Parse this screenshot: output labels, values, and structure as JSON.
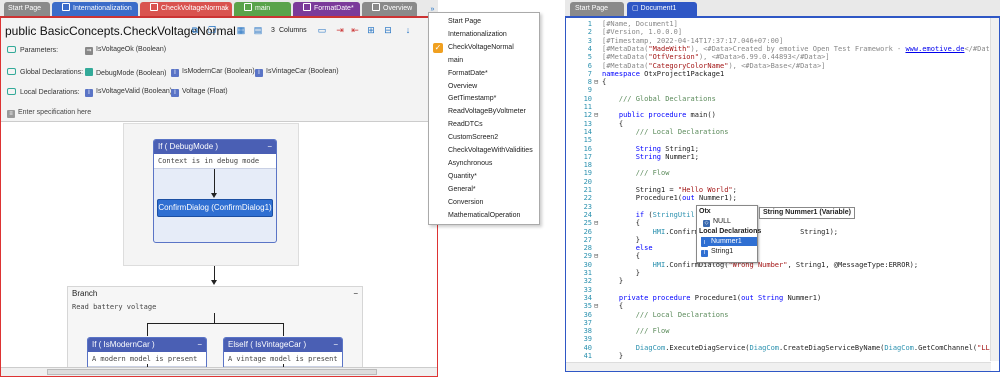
{
  "left": {
    "tabs": [
      {
        "label": "Start Page",
        "color": "#8a8a8a"
      },
      {
        "label": "Internationalization",
        "color": "#3b6cc9"
      },
      {
        "label": "CheckVoltageNormal",
        "color": "#d9534f"
      },
      {
        "label": "main",
        "color": "#5aa34a"
      },
      {
        "label": "FormatDate*",
        "color": "#7b3a9a"
      },
      {
        "label": "Overview",
        "color": "#8a8a8a"
      }
    ],
    "title": "public BasicConcepts.CheckVoltageNormal",
    "columns_label": "3",
    "columns_text": "Columns",
    "parameters_label": "Parameters:",
    "global_label": "Global Declarations:",
    "local_label": "Local Declarations:",
    "params": [
      "IsVoltageOk (Boolean)"
    ],
    "globals": [
      "DebugMode (Boolean)",
      "IsModernCar (Boolean)",
      "IsVintageCar (Boolean)"
    ],
    "locals": [
      "IsVoltageValid (Boolean)",
      "Voltage (Float)"
    ],
    "spec_placeholder": "Enter specification here",
    "if_debug": {
      "title": "If ( DebugMode )",
      "desc": "Context is in debug mode",
      "action": "ConfirmDialog (ConfirmDialog1)"
    },
    "branch": {
      "title": "Branch",
      "desc": "Read battery voltage"
    },
    "if_modern": {
      "title": "If ( IsModernCar )",
      "desc": "A modern model is present"
    },
    "elseif_vintage": {
      "title": "ElseIf ( IsVintageCar )",
      "desc": "A vintage model is present"
    }
  },
  "dropdown": {
    "items": [
      "Start Page",
      "Internationalization",
      "CheckVoltageNormal",
      "main",
      "FormatDate*",
      "Overview",
      "GetTimestamp*",
      "ReadVoltageByVoltmeter",
      "ReadDTCs",
      "CustomScreen2",
      "CheckVoltageWithValidities",
      "Asynchronous",
      "Quantity*",
      "General*",
      "Conversion",
      "MathematicalOperation"
    ],
    "checked_index": 2
  },
  "right": {
    "tabs": [
      {
        "label": "Start Page",
        "color": "#8a8a8a"
      },
      {
        "label": "Document1",
        "color": "#2f57c5"
      }
    ],
    "code_lines": [
      {
        "n": "1",
        "parts": [
          [
            "cm",
            "[#Name, Document1]"
          ]
        ]
      },
      {
        "n": "2",
        "parts": [
          [
            "cm",
            "[#Version, 1.0.0.0]"
          ]
        ]
      },
      {
        "n": "3",
        "parts": [
          [
            "cm",
            "[#Timestamp, 2022-04-14T17:37:17.046+07:00]"
          ]
        ]
      },
      {
        "n": "4",
        "parts": [
          [
            "cm",
            "[#MetaData("
          ],
          [
            "str",
            "\"MadeWith\""
          ],
          [
            "cm",
            "), <#Data>Created by emotive Open Test Framework - "
          ],
          [
            "url",
            "www.emotive.de"
          ],
          [
            "cm",
            "</#Data>]"
          ]
        ]
      },
      {
        "n": "5",
        "parts": [
          [
            "cm",
            "[#MetaData("
          ],
          [
            "str",
            "\"OtfVersion\""
          ],
          [
            "cm",
            "), <#Data>6.99.0.44893</#Data>]"
          ]
        ]
      },
      {
        "n": "6",
        "parts": [
          [
            "cm",
            "[#MetaData("
          ],
          [
            "str",
            "\"CategoryColorName\""
          ],
          [
            "cm",
            "), <#Data>Base</#Data>]"
          ]
        ]
      },
      {
        "n": "7",
        "parts": [
          [
            "kw",
            "namespace"
          ],
          [
            "fn",
            " OtxProject1Package1"
          ]
        ]
      },
      {
        "n": "8",
        "parts": [
          [
            "fn",
            "{"
          ]
        ]
      },
      {
        "n": "9",
        "parts": [
          [
            "fn",
            ""
          ]
        ]
      },
      {
        "n": "10",
        "parts": [
          [
            "grn",
            "    /// Global Declarations"
          ]
        ]
      },
      {
        "n": "11",
        "parts": [
          [
            "fn",
            ""
          ]
        ]
      },
      {
        "n": "12",
        "parts": [
          [
            "kw",
            "    public procedure"
          ],
          [
            "fn",
            " main()"
          ]
        ]
      },
      {
        "n": "13",
        "parts": [
          [
            "fn",
            "    {"
          ]
        ]
      },
      {
        "n": "14",
        "parts": [
          [
            "grn",
            "        /// Local Declarations"
          ]
        ]
      },
      {
        "n": "15",
        "parts": [
          [
            "fn",
            ""
          ]
        ]
      },
      {
        "n": "16",
        "parts": [
          [
            "kw",
            "        String"
          ],
          [
            "fn",
            " String1;"
          ]
        ]
      },
      {
        "n": "17",
        "parts": [
          [
            "kw",
            "        String"
          ],
          [
            "fn",
            " Nummer1;"
          ]
        ]
      },
      {
        "n": "18",
        "parts": [
          [
            "fn",
            ""
          ]
        ]
      },
      {
        "n": "19",
        "parts": [
          [
            "grn",
            "        /// Flow"
          ]
        ]
      },
      {
        "n": "20",
        "parts": [
          [
            "fn",
            ""
          ]
        ]
      },
      {
        "n": "21",
        "parts": [
          [
            "fn",
            "        String1 = "
          ],
          [
            "str",
            "\"Hello World\""
          ],
          [
            "fn",
            ";"
          ]
        ]
      },
      {
        "n": "22",
        "parts": [
          [
            "fn",
            "        Procedure1("
          ],
          [
            "kw",
            "out"
          ],
          [
            "fn",
            " Nummer1);"
          ]
        ]
      },
      {
        "n": "23",
        "parts": [
          [
            "fn",
            ""
          ]
        ]
      },
      {
        "n": "24",
        "parts": [
          [
            "kw",
            "        if"
          ],
          [
            "fn",
            " ("
          ],
          [
            "cls",
            "StringUtil"
          ],
          [
            "fn",
            "..."
          ]
        ]
      },
      {
        "n": "25",
        "parts": [
          [
            "fn",
            "        {"
          ]
        ]
      },
      {
        "n": "26",
        "parts": [
          [
            "cls",
            "            HMI"
          ],
          [
            "fn",
            ".ConfirmD"
          ],
          [
            "fn",
            "                       String1);"
          ]
        ]
      },
      {
        "n": "27",
        "parts": [
          [
            "fn",
            "        }"
          ]
        ]
      },
      {
        "n": "28",
        "parts": [
          [
            "kw",
            "        else"
          ]
        ]
      },
      {
        "n": "29",
        "parts": [
          [
            "fn",
            "        {"
          ]
        ]
      },
      {
        "n": "30",
        "parts": [
          [
            "cls",
            "            HMI"
          ],
          [
            "fn",
            ".ConfirmDialog("
          ],
          [
            "str",
            "\"Wrong Number\""
          ],
          [
            "fn",
            ", String1, @MessageType:ERROR);"
          ]
        ]
      },
      {
        "n": "31",
        "parts": [
          [
            "fn",
            "        }"
          ]
        ]
      },
      {
        "n": "32",
        "parts": [
          [
            "fn",
            "    }"
          ]
        ]
      },
      {
        "n": "33",
        "parts": [
          [
            "fn",
            ""
          ]
        ]
      },
      {
        "n": "34",
        "parts": [
          [
            "kw",
            "    private procedure"
          ],
          [
            "fn",
            " Procedure1("
          ],
          [
            "kw",
            "out String"
          ],
          [
            "fn",
            " Nummer1)"
          ]
        ]
      },
      {
        "n": "35",
        "parts": [
          [
            "fn",
            "    {"
          ]
        ]
      },
      {
        "n": "36",
        "parts": [
          [
            "grn",
            "        /// Local Declarations"
          ]
        ]
      },
      {
        "n": "37",
        "parts": [
          [
            "fn",
            ""
          ]
        ]
      },
      {
        "n": "38",
        "parts": [
          [
            "grn",
            "        /// Flow"
          ]
        ]
      },
      {
        "n": "39",
        "parts": [
          [
            "fn",
            ""
          ]
        ]
      },
      {
        "n": "40",
        "parts": [
          [
            "cls",
            "        DiagCom"
          ],
          [
            "fn",
            ".ExecuteDiagService("
          ],
          [
            "cls",
            "DiagCom"
          ],
          [
            "fn",
            ".CreateDiagServiceByName("
          ],
          [
            "cls",
            "DiagCom"
          ],
          [
            "fn",
            ".GetComChannel("
          ],
          [
            "str",
            "\"LL_A"
          ]
        ]
      },
      {
        "n": "41",
        "parts": [
          [
            "fn",
            "    }"
          ]
        ]
      }
    ],
    "popup": {
      "header": "Otx",
      "items": [
        "NULL",
        "Local Declarations",
        "Nummer1",
        "String1"
      ]
    },
    "tooltip": "String Nummer1 (Variable)"
  }
}
